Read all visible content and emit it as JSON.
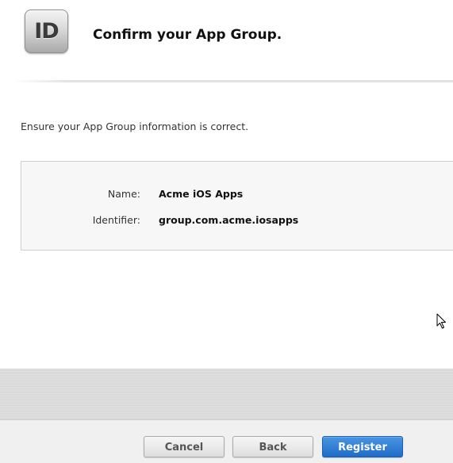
{
  "header": {
    "app_icon_text": "ID",
    "title": "Confirm your App Group."
  },
  "instruction": "Ensure your App Group information is correct.",
  "details": {
    "name_label": "Name:",
    "name_value": "Acme iOS Apps",
    "identifier_label": "Identifier:",
    "identifier_value": "group.com.acme.iosapps"
  },
  "buttons": {
    "cancel_label": "Cancel",
    "back_label": "Back",
    "register_label": "Register"
  },
  "colors": {
    "primary_button": "#2a78d0",
    "footer_band": "#dcdcdc",
    "info_box_bg": "#f7f7f7"
  },
  "icons": {
    "app_icon": "app-id-icon",
    "pointer": "mouse-pointer-icon"
  }
}
